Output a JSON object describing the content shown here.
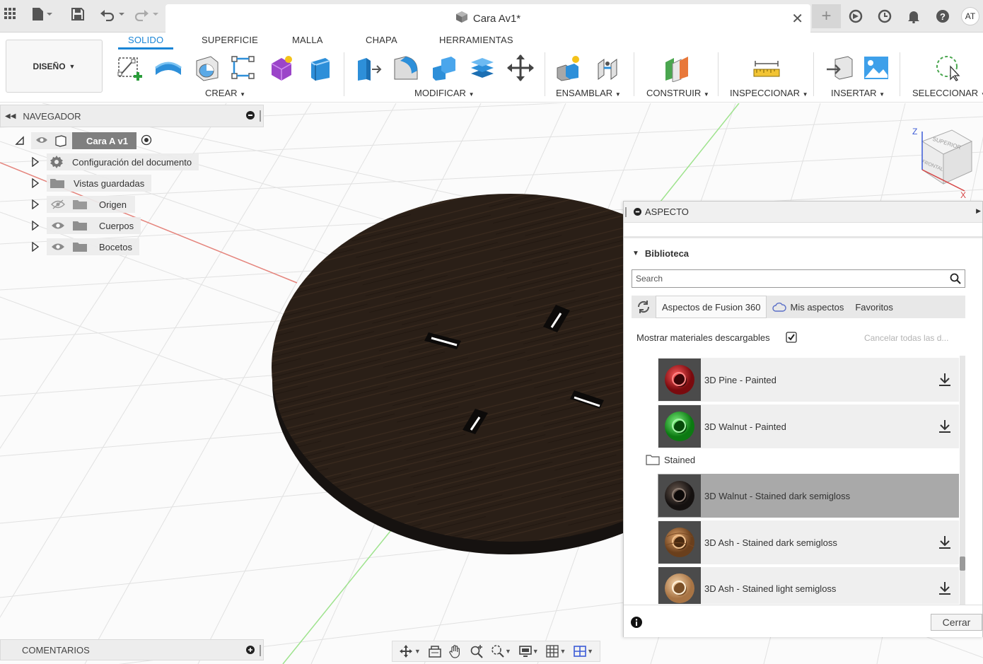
{
  "window": {
    "doc_title": "Cara Av1*",
    "avatar": "AT"
  },
  "toolbar": {
    "workspace": "DISEÑO",
    "tabs": [
      "SOLIDO",
      "SUPERFICIE",
      "MALLA",
      "CHAPA",
      "HERRAMIENTAS"
    ],
    "active_tab": "SOLIDO",
    "groups": [
      "CREAR",
      "MODIFICAR",
      "ENSAMBLAR",
      "CONSTRUIR",
      "INSPECCIONAR",
      "INSERTAR",
      "SELECCIONAR"
    ]
  },
  "navigator": {
    "title": "NAVEGADOR",
    "root": "Cara A v1",
    "items": [
      {
        "label": "Configuración del documento",
        "icon": "gear-icon"
      },
      {
        "label": "Vistas guardadas",
        "icon": "folder-icon"
      },
      {
        "label": "Origen",
        "icon": "folder-icon",
        "visibility": "hidden"
      },
      {
        "label": "Cuerpos",
        "icon": "folder-icon",
        "visibility": "visible"
      },
      {
        "label": "Bocetos",
        "icon": "folder-icon",
        "visibility": "visible"
      }
    ]
  },
  "viewcube": {
    "top": "SUPERIOR",
    "front": "FRONTAL",
    "z": "Z",
    "x": "X"
  },
  "aspecto": {
    "title": "ASPECTO",
    "section": "Biblioteca",
    "search_placeholder": "Search",
    "tabs": [
      "Aspectos de Fusion 360",
      "Mis aspectos",
      "Favoritos"
    ],
    "show_downloadable": "Mostrar materiales descargables",
    "show_downloadable_checked": true,
    "cancel_all": "Cancelar todas las d...",
    "folder": "Stained",
    "materials": [
      {
        "label": "3D Pine - Painted",
        "color": "#c0161b"
      },
      {
        "label": "3D Walnut - Painted",
        "color": "#22b02a"
      },
      {
        "label": "3D Walnut - Stained dark semigloss",
        "color": "#2b2623",
        "selected": true
      },
      {
        "label": "3D Ash - Stained dark semigloss",
        "color": "#a06a3c"
      },
      {
        "label": "3D Ash - Stained light semigloss",
        "color": "#c99c6a"
      }
    ],
    "close": "Cerrar"
  },
  "comments": {
    "title": "COMENTARIOS"
  }
}
